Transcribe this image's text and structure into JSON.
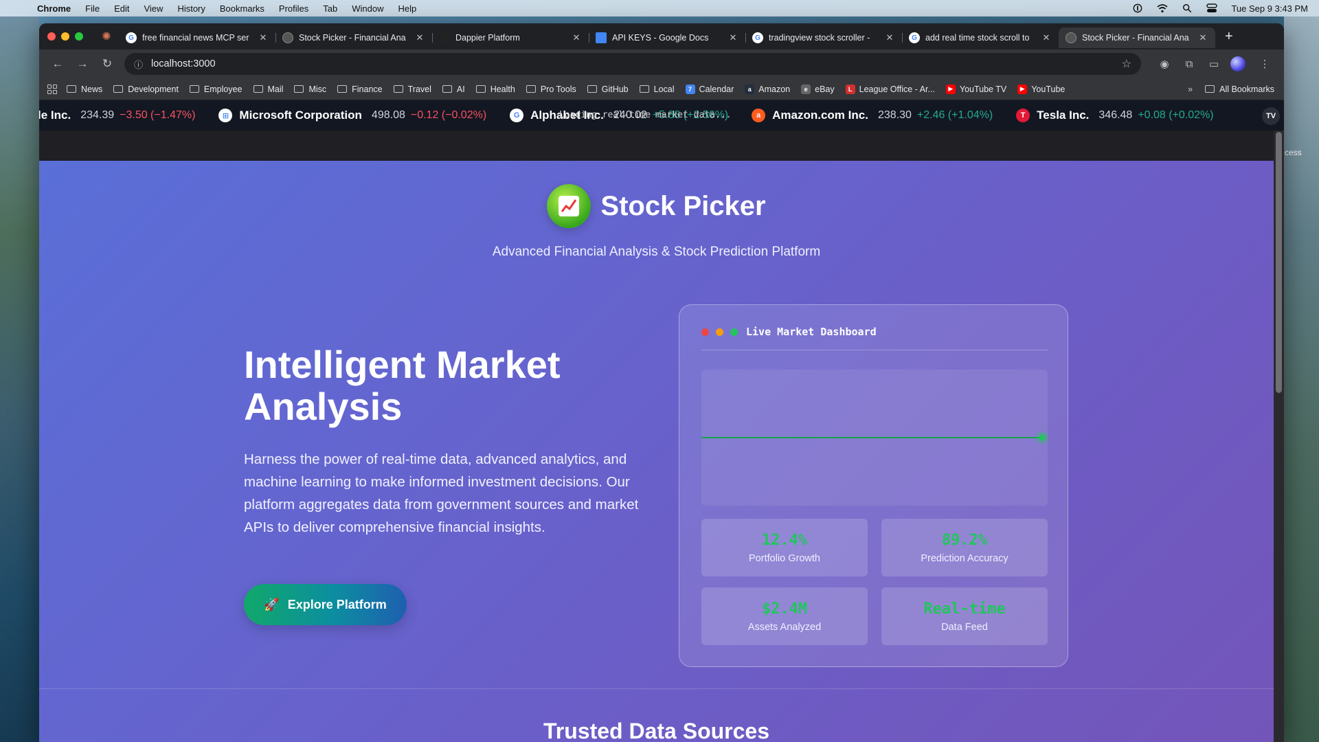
{
  "menubar": {
    "app": "Chrome",
    "items": [
      "File",
      "Edit",
      "View",
      "History",
      "Bookmarks",
      "Profiles",
      "Tab",
      "Window",
      "Help"
    ],
    "clock": "Tue Sep 9  3:43 PM"
  },
  "tabs": [
    {
      "title": "free financial news MCP ser",
      "favicon": "google"
    },
    {
      "title": "Stock Picker - Financial Ana",
      "favicon": "gray"
    },
    {
      "title": "Dappier Platform",
      "favicon": "dappier"
    },
    {
      "title": "API KEYS - Google Docs",
      "favicon": "docs"
    },
    {
      "title": "tradingview stock scroller -",
      "favicon": "google"
    },
    {
      "title": "add real time stock scroll to",
      "favicon": "google"
    },
    {
      "title": "Stock Picker - Financial Ana",
      "favicon": "gray",
      "active": true
    }
  ],
  "toolbar": {
    "url": "localhost:3000"
  },
  "bookmarks": {
    "folders": [
      "News",
      "Development",
      "Employee",
      "Mail",
      "Misc",
      "Finance",
      "Travel",
      "AI",
      "Health",
      "Pro Tools",
      "GitHub",
      "Local"
    ],
    "links": [
      {
        "label": "Calendar",
        "color": "#4285f4",
        "glyph": "7"
      },
      {
        "label": "Amazon",
        "color": "#232f3e",
        "glyph": "a"
      },
      {
        "label": "eBay",
        "color": "#666666",
        "glyph": "e"
      },
      {
        "label": "League Office - Ar...",
        "color": "#d32f2f",
        "glyph": "L"
      },
      {
        "label": "YouTube TV",
        "color": "#ff0000",
        "glyph": "▶"
      },
      {
        "label": "YouTube",
        "color": "#ff0000",
        "glyph": "▶"
      }
    ],
    "all_bookmarks": "All Bookmarks"
  },
  "ticker": {
    "loading_text": "Loading real-time market data...",
    "items": [
      {
        "name": "le Inc.",
        "price": "234.39",
        "change": "−3.50 (−1.47%)",
        "direction": "down",
        "logo": "",
        "logo_color": ""
      },
      {
        "name": "Microsoft Corporation",
        "price": "498.08",
        "change": "−0.12 (−0.02%)",
        "direction": "down",
        "logo": "⊞",
        "logo_color": "#ffffff"
      },
      {
        "name": "Alphabet Inc.",
        "price": "240.02",
        "change": "+5.88 (+2.56%)",
        "direction": "up",
        "logo": "G",
        "logo_color": "#ffffff"
      },
      {
        "name": "Amazon.com Inc.",
        "price": "238.30",
        "change": "+2.46 (+1.04%)",
        "direction": "up",
        "logo": "a",
        "logo_color": "#ff5a1f"
      },
      {
        "name": "Tesla Inc.",
        "price": "346.48",
        "change": "+0.08 (+0.02%)",
        "direction": "up",
        "logo": "T",
        "logo_color": "#e31937"
      }
    ],
    "tv_logo": "TV"
  },
  "page": {
    "brand_icon": "📈",
    "brand_title": "Stock Picker",
    "tagline": "Advanced Financial Analysis & Stock Prediction Platform",
    "hero_heading": "Intelligent Market Analysis",
    "hero_text": "Harness the power of real-time data, advanced analytics, and machine learning to make informed investment decisions. Our platform aggregates data from government sources and market APIs to deliver comprehensive financial insights.",
    "cta_icon": "🚀",
    "cta_label": "Explore Platform",
    "dashboard": {
      "title": "Live Market Dashboard",
      "line_color": "#16a34a",
      "metrics": [
        {
          "value": "12.4%",
          "label": "Portfolio Growth"
        },
        {
          "value": "89.2%",
          "label": "Prediction Accuracy"
        },
        {
          "value": "$2.4M",
          "label": "Assets Analyzed"
        },
        {
          "value": "Real-time",
          "label": "Data Feed"
        }
      ]
    },
    "section_title": "Trusted Data Sources"
  },
  "desktop": {
    "right_edge_text": "cess"
  }
}
